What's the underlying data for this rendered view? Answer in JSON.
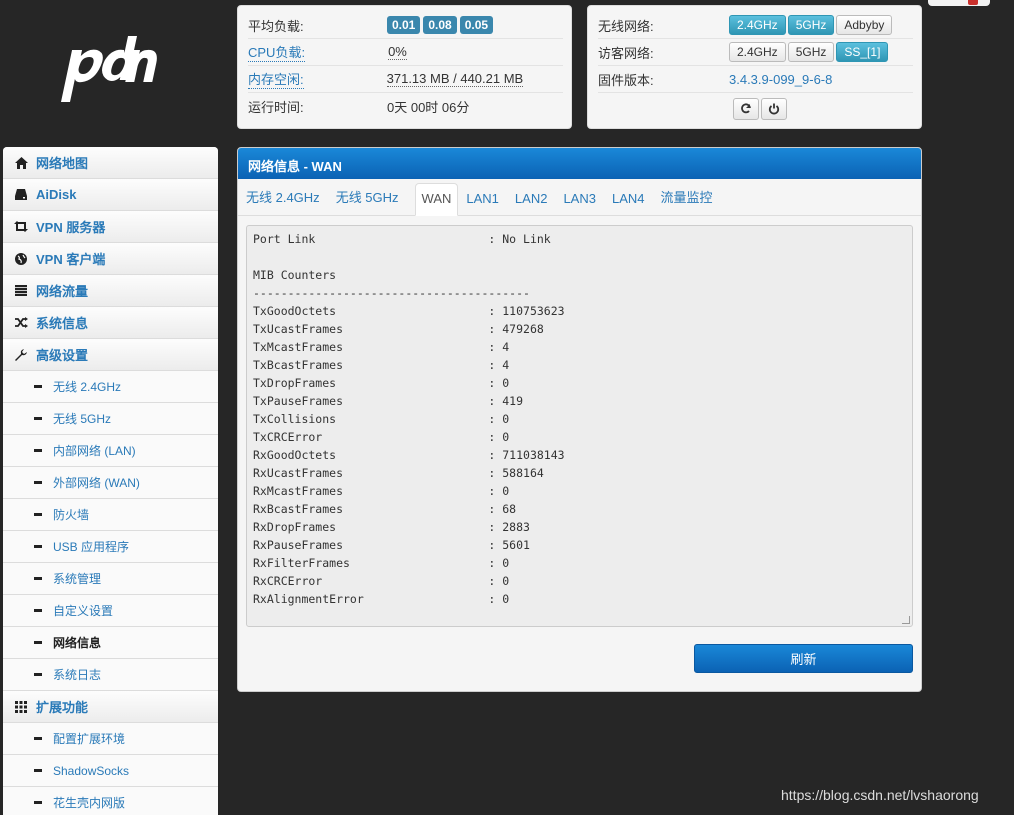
{
  "logo": {
    "text": "pdcn"
  },
  "status_left": {
    "rows": [
      {
        "label": "平均负载:",
        "badges": [
          "0.01",
          "0.08",
          "0.05"
        ]
      },
      {
        "label": "CPU负载:",
        "value": "0%"
      },
      {
        "label": "内存空闲:",
        "value": "371.13 MB / 440.21 MB"
      },
      {
        "label": "运行时间:",
        "value": "0天 00时 06分"
      }
    ]
  },
  "status_right": {
    "wireless_label": "无线网络:",
    "wireless_buttons": [
      "2.4GHz",
      "5GHz",
      "Adbyby"
    ],
    "guest_label": "访客网络:",
    "guest_buttons": [
      "2.4GHz",
      "5GHz",
      "SS_[1]"
    ],
    "firmware_label": "固件版本:",
    "firmware_value": "3.4.3.9-099_9-6-8"
  },
  "sidebar": {
    "items": [
      {
        "label": "网络地图",
        "icon": "home-icon"
      },
      {
        "label": "AiDisk",
        "icon": "disk-icon"
      },
      {
        "label": "VPN 服务器",
        "icon": "retweet-icon"
      },
      {
        "label": "VPN 客户端",
        "icon": "globe-icon"
      },
      {
        "label": "网络流量",
        "icon": "list-icon"
      },
      {
        "label": "系统信息",
        "icon": "random-icon"
      },
      {
        "label": "高级设置",
        "icon": "wrench-icon"
      }
    ],
    "advanced_sub": [
      "无线 2.4GHz",
      "无线 5GHz",
      "内部网络 (LAN)",
      "外部网络 (WAN)",
      "防火墙",
      "USB 应用程序",
      "系统管理",
      "自定义设置",
      "网络信息",
      "系统日志"
    ],
    "ext_label": "扩展功能",
    "ext_sub": [
      "配置扩展环境",
      "ShadowSocks",
      "花生壳内网版"
    ]
  },
  "panel": {
    "title": "网络信息 - WAN",
    "tabs": [
      "无线 2.4GHz",
      "无线 5GHz",
      "WAN",
      "LAN1",
      "LAN2",
      "LAN3",
      "LAN4",
      "流量监控"
    ],
    "log": "Port Link                         : No Link\n\nMIB Counters\n----------------------------------------\nTxGoodOctets                      : 110753623\nTxUcastFrames                     : 479268\nTxMcastFrames                     : 4\nTxBcastFrames                     : 4\nTxDropFrames                      : 0\nTxPauseFrames                     : 419\nTxCollisions                      : 0\nTxCRCError                        : 0\nRxGoodOctets                      : 711038143\nRxUcastFrames                     : 588164\nRxMcastFrames                     : 0\nRxBcastFrames                     : 68\nRxDropFrames                      : 2883\nRxPauseFrames                     : 5601\nRxFilterFrames                    : 0\nRxCRCError                        : 0\nRxAlignmentError                  : 0",
    "refresh_label": "刷新"
  },
  "watermark": "https://blog.csdn.net/lvshaorong"
}
